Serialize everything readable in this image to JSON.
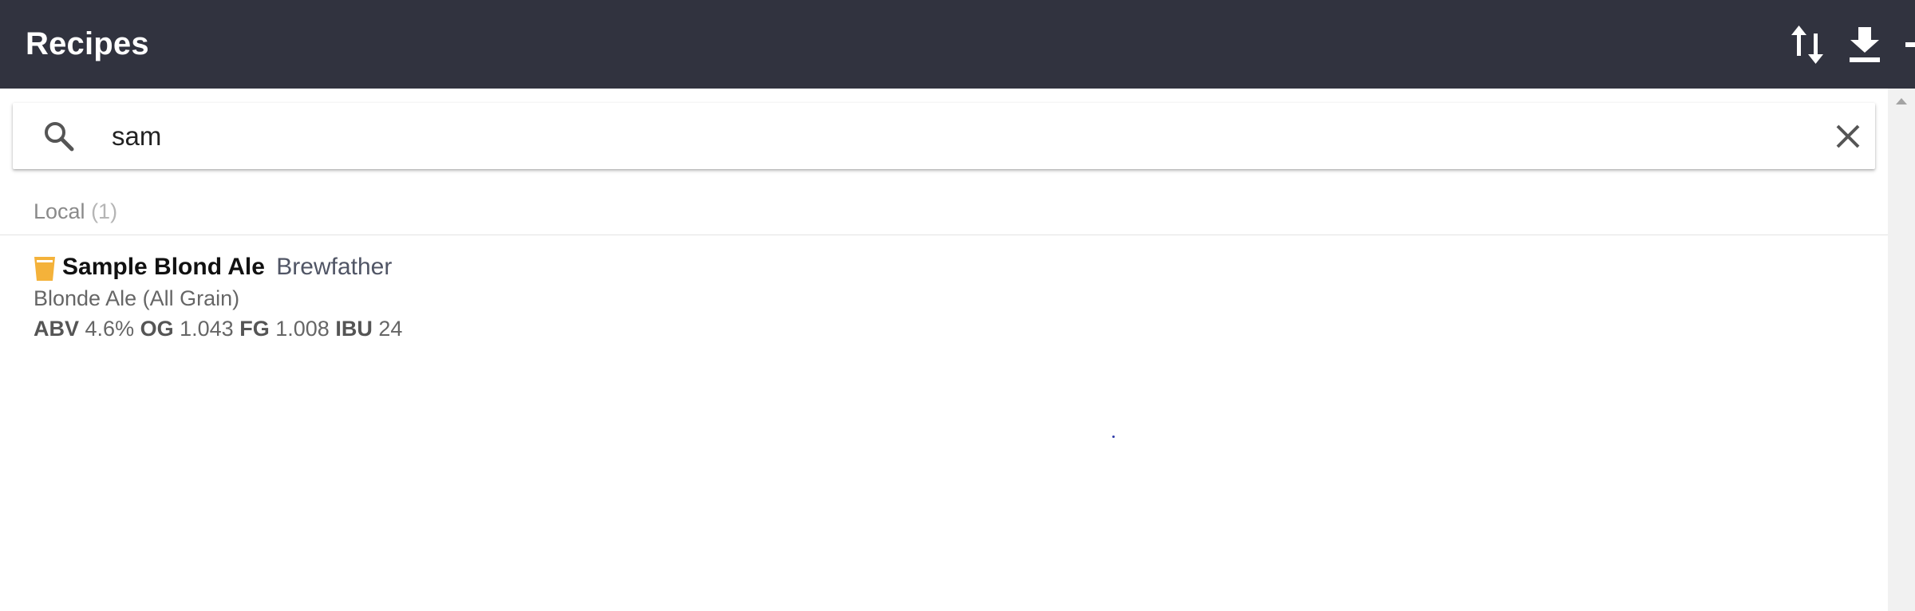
{
  "header": {
    "title": "Recipes",
    "actions": [
      {
        "name": "sort",
        "icon": "sort-arrows-icon"
      },
      {
        "name": "import",
        "icon": "download-icon"
      },
      {
        "name": "add",
        "icon": "plus-icon"
      }
    ],
    "background_color": "#31333f"
  },
  "search": {
    "value": "sam",
    "icon": "search-icon",
    "clear_icon": "close-icon"
  },
  "section": {
    "label": "Local",
    "count": "(1)"
  },
  "recipes": [
    {
      "icon": "beer-glass-icon",
      "icon_color": "#f4b23a",
      "name": "Sample Blond Ale",
      "author": "Brewfather",
      "style": "Blonde Ale (All Grain)",
      "stats": {
        "abv_label": "ABV",
        "abv": "4.6%",
        "og_label": "OG",
        "og": "1.043",
        "fg_label": "FG",
        "fg": "1.008",
        "ibu_label": "IBU",
        "ibu": "24"
      }
    }
  ]
}
